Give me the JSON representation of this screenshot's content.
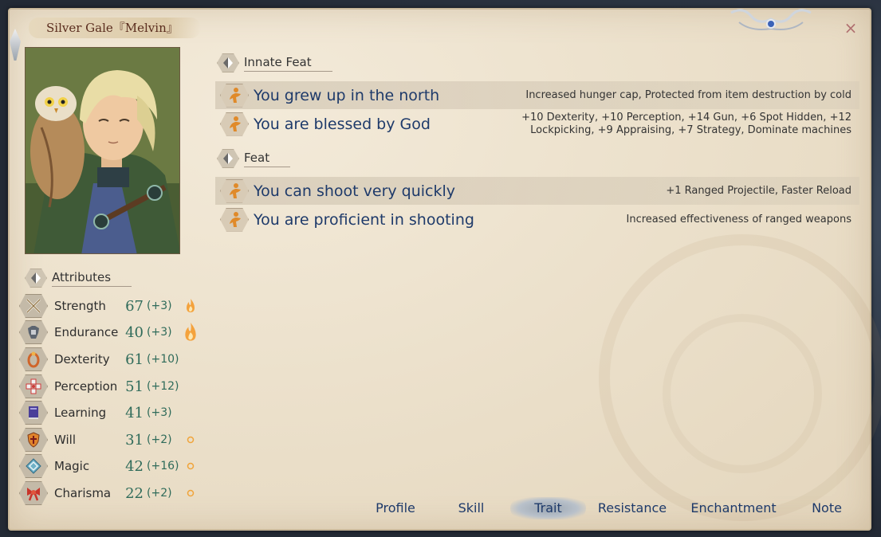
{
  "character": {
    "title": "Silver Gale『Melvin』"
  },
  "window": {
    "close_glyph": "×"
  },
  "sections": {
    "innate_label": "Innate Feat",
    "feat_label": "Feat",
    "attributes_label": "Attributes"
  },
  "innate_feats": [
    {
      "name": "You grew up in the north",
      "desc": "Increased hunger cap, Protected from item destruction by cold",
      "icon": "leaping-figure-icon"
    },
    {
      "name": "You are blessed by God",
      "desc": "+10 Dexterity, +10 Perception, +14 Gun, +6 Spot Hidden, +12 Lockpicking, +9 Appraising, +7 Strategy, Dominate machines",
      "icon": "leaping-figure-icon"
    }
  ],
  "feats": [
    {
      "name": "You can shoot very quickly",
      "desc": "+1 Ranged Projectile, Faster Reload",
      "icon": "leaping-figure-icon"
    },
    {
      "name": "You are proficient in shooting",
      "desc": "Increased effectiveness of ranged weapons",
      "icon": "leaping-figure-icon"
    }
  ],
  "attributes": [
    {
      "name": "Strength",
      "value": "67",
      "bonus": "(+3)",
      "icon": "crossed-swords-icon",
      "flame": "small"
    },
    {
      "name": "Endurance",
      "value": "40",
      "bonus": "(+3)",
      "icon": "armor-icon",
      "flame": "large"
    },
    {
      "name": "Dexterity",
      "value": "61",
      "bonus": "(+10)",
      "icon": "ring-icon",
      "flame": "none"
    },
    {
      "name": "Perception",
      "value": "51",
      "bonus": "(+12)",
      "icon": "cross-target-icon",
      "flame": "none"
    },
    {
      "name": "Learning",
      "value": "41",
      "bonus": "(+3)",
      "icon": "book-icon",
      "flame": "none"
    },
    {
      "name": "Will",
      "value": "31",
      "bonus": "(+2)",
      "icon": "shield-icon",
      "flame": "dot"
    },
    {
      "name": "Magic",
      "value": "42",
      "bonus": "(+16)",
      "icon": "magic-rune-icon",
      "flame": "dot"
    },
    {
      "name": "Charisma",
      "value": "22",
      "bonus": "(+2)",
      "icon": "ribbon-icon",
      "flame": "dot"
    }
  ],
  "tabs": [
    {
      "label": "Profile",
      "active": false
    },
    {
      "label": "Skill",
      "active": false
    },
    {
      "label": "Trait",
      "active": true
    },
    {
      "label": "Resistance",
      "active": false
    },
    {
      "label": "Enchantment",
      "active": false
    },
    {
      "label": "Note",
      "active": false
    }
  ],
  "colors": {
    "feat_text": "#1e3a6a",
    "attr_value": "#2f6b5a",
    "name_text": "#5b2e1f",
    "parchment": "#ece1cc"
  }
}
